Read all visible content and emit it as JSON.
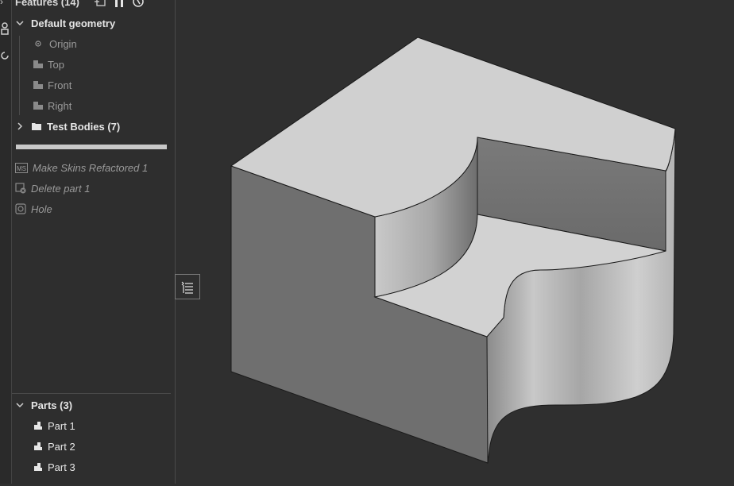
{
  "features_panel": {
    "title": "Features (14)",
    "default_geometry": {
      "label": "Default geometry",
      "items": [
        "Origin",
        "Top",
        "Front",
        "Right"
      ]
    },
    "test_bodies": {
      "label": "Test Bodies (7)"
    },
    "features": [
      {
        "label": "Make Skins Refactored 1",
        "badge": "MS"
      },
      {
        "label": "Delete part 1"
      },
      {
        "label": "Hole"
      }
    ]
  },
  "parts_panel": {
    "title": "Parts (3)",
    "items": [
      "Part 1",
      "Part 2",
      "Part 3"
    ]
  }
}
